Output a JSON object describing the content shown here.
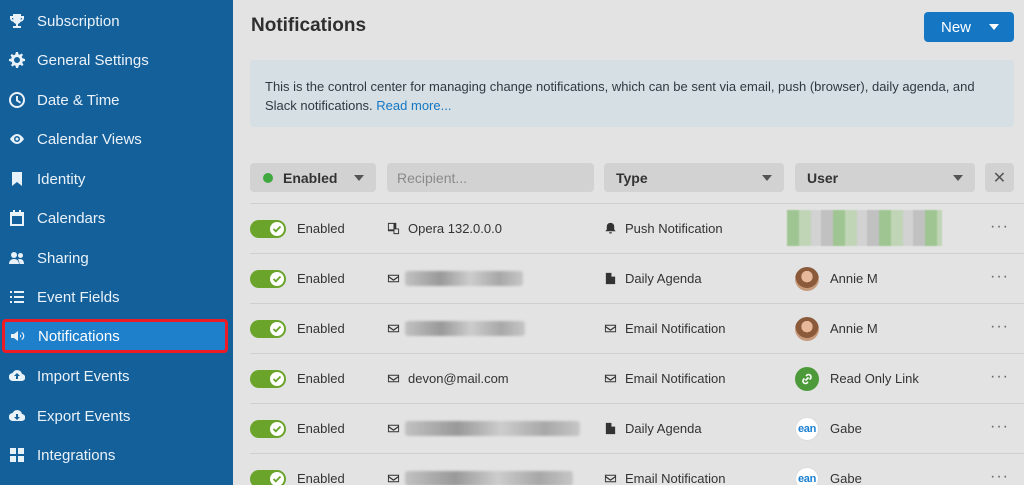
{
  "sidebar": {
    "items": [
      {
        "label": "Subscription",
        "icon": "trophy-icon"
      },
      {
        "label": "General Settings",
        "icon": "gear-icon"
      },
      {
        "label": "Date & Time",
        "icon": "clock-icon"
      },
      {
        "label": "Calendar Views",
        "icon": "eye-icon"
      },
      {
        "label": "Identity",
        "icon": "bookmark-icon"
      },
      {
        "label": "Calendars",
        "icon": "calendar-icon"
      },
      {
        "label": "Sharing",
        "icon": "users-icon"
      },
      {
        "label": "Event Fields",
        "icon": "list-icon"
      },
      {
        "label": "Notifications",
        "icon": "megaphone-icon",
        "active": true
      },
      {
        "label": "Import Events",
        "icon": "cloud-upload-icon"
      },
      {
        "label": "Export Events",
        "icon": "cloud-download-icon"
      },
      {
        "label": "Integrations",
        "icon": "grid-icon"
      }
    ]
  },
  "header": {
    "title": "Notifications",
    "new_label": "New"
  },
  "info": {
    "text": "This is the control center for managing change notifications, which can be sent via email, push (browser), daily agenda, and Slack notifications.",
    "link": "Read more..."
  },
  "filters": {
    "status": "Enabled",
    "recipient_placeholder": "Recipient...",
    "type": "Type",
    "user": "User",
    "clear": "✕"
  },
  "rows": [
    {
      "status": "Enabled",
      "recipient_icon": "device-icon",
      "recipient": "Opera 132.0.0.0",
      "type_icon": "bell-icon",
      "type": "Push Notification",
      "user": "",
      "menu": "···"
    },
    {
      "status": "Enabled",
      "recipient_icon": "envelope-icon",
      "recipient": "",
      "type_icon": "document-icon",
      "type": "Daily Agenda",
      "user": "Annie M",
      "menu": "···"
    },
    {
      "status": "Enabled",
      "recipient_icon": "envelope-icon",
      "recipient": "",
      "type_icon": "envelope-icon",
      "type": "Email Notification",
      "user": "Annie M",
      "menu": "···"
    },
    {
      "status": "Enabled",
      "recipient_icon": "envelope-icon",
      "recipient": "devon@mail.com",
      "type_icon": "envelope-icon",
      "type": "Email Notification",
      "user": "Read Only Link",
      "menu": "···"
    },
    {
      "status": "Enabled",
      "recipient_icon": "envelope-icon",
      "recipient": "",
      "type_icon": "document-icon",
      "type": "Daily Agenda",
      "user": "Gabe",
      "user_avatar_text": "ean",
      "menu": "···"
    },
    {
      "status": "Enabled",
      "recipient_icon": "envelope-icon",
      "recipient": "",
      "type_icon": "envelope-icon",
      "type": "Email Notification",
      "user": "Gabe",
      "user_avatar_text": "ean",
      "menu": "···"
    }
  ],
  "colors": {
    "sidebar": "#14609b",
    "active": "#1e7fcb",
    "highlight": "#ee1b24",
    "toggle_on": "#6aa42a",
    "accent": "#1577c4"
  }
}
